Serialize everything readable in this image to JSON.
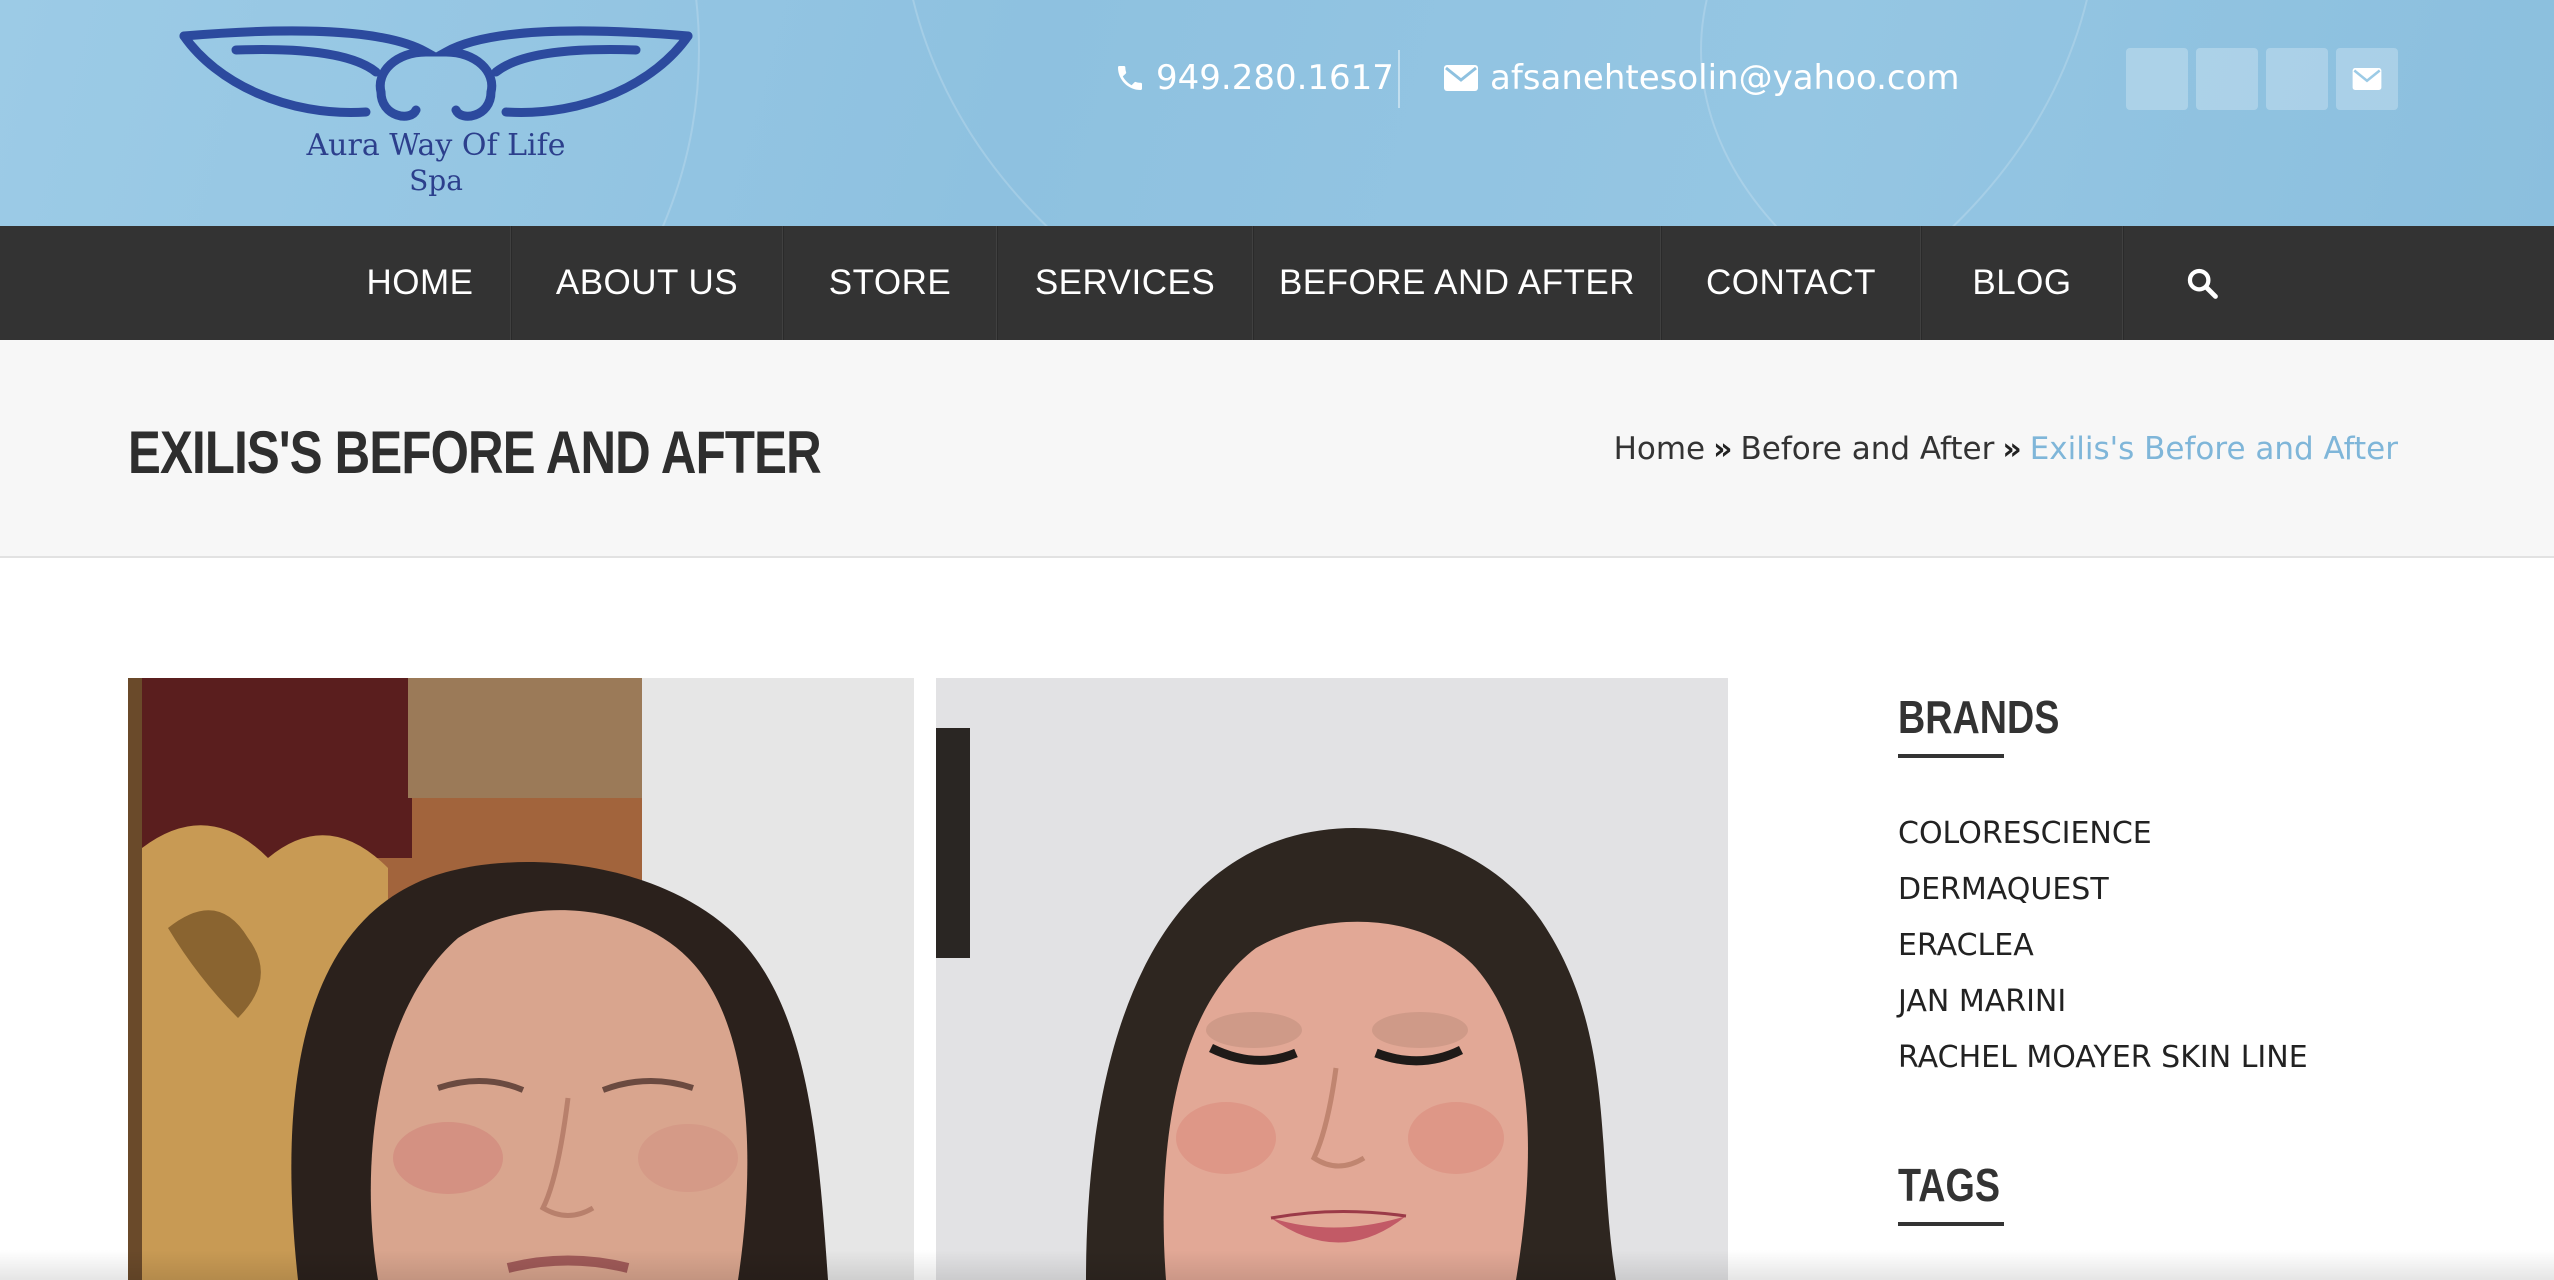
{
  "header": {
    "logo_line1": "Aura Way Of Life",
    "logo_line2": "Spa",
    "phone": "949.280.1617",
    "email": "afsanehtesolin@yahoo.com",
    "social_icons": [
      "social-icon",
      "social-icon",
      "social-icon",
      "envelope-icon"
    ]
  },
  "nav": {
    "items": [
      "HOME",
      "ABOUT US",
      "STORE",
      "SERVICES",
      "BEFORE AND AFTER",
      "CONTACT",
      "BLOG"
    ],
    "search_icon": "search-icon"
  },
  "page": {
    "title": "EXILIS'S BEFORE AND AFTER",
    "breadcrumb": [
      "Home",
      "Before and After",
      "Exilis's Before and After"
    ]
  },
  "sidebar": {
    "brands_heading": "BRANDS",
    "brands": [
      "COLORESCIENCE",
      "DERMAQUEST",
      "ERACLEA",
      "JAN MARINI",
      "RACHEL MOAYER SKIN LINE"
    ],
    "tags_heading": "TAGS"
  },
  "colors": {
    "header_bg": "#8ec1e0",
    "nav_bg": "#333333",
    "title_band_bg": "#f7f7f7",
    "accent": "#7fb6d9",
    "logo_blue": "#2c3f8c"
  }
}
